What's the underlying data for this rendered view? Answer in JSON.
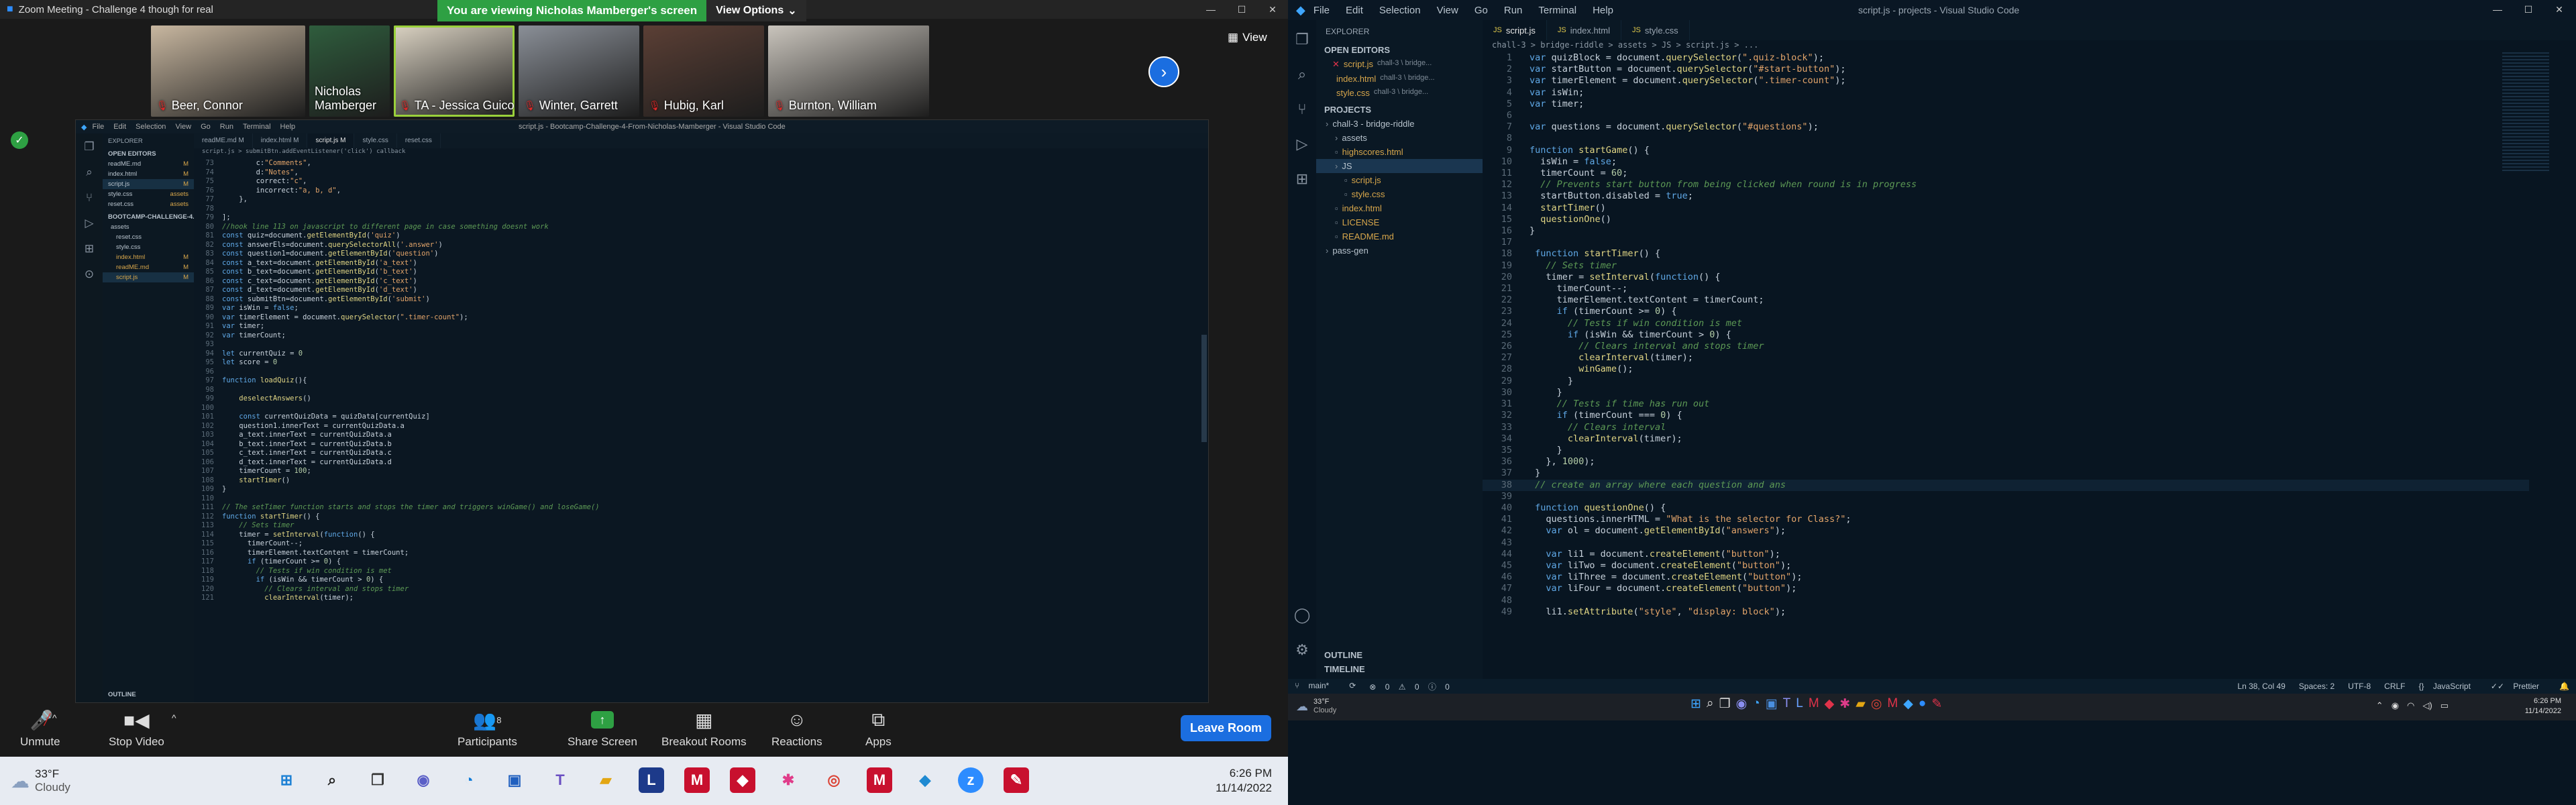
{
  "zoom": {
    "window_title": "Zoom Meeting - Challenge 4 though for real",
    "banner": {
      "message": "You are viewing Nicholas Mamberger's screen",
      "view_options": "View Options"
    },
    "participants": [
      {
        "name": "Beer, Connor",
        "muted": true,
        "bg": "#c8b7a0"
      },
      {
        "name": "Nicholas Mamberger",
        "muted": false,
        "bg": "#2f5d3d"
      },
      {
        "name": "TA - Jessica Guico",
        "muted": true,
        "bg": "#dad2c2"
      },
      {
        "name": "Winter, Garrett",
        "muted": true,
        "bg": "#8a8f97"
      },
      {
        "name": "Hubig, Karl",
        "muted": true,
        "bg": "#5b3f35"
      },
      {
        "name": "Burnton, William",
        "muted": true,
        "bg": "#c9c4bc"
      }
    ],
    "view_label": "View",
    "toolbar": {
      "unmute": "Unmute",
      "stop_video": "Stop Video",
      "participants": "Participants",
      "participants_count": "8",
      "share_screen": "Share Screen",
      "breakout_rooms": "Breakout Rooms",
      "reactions": "Reactions",
      "apps": "Apps",
      "leave": "Leave Room"
    }
  },
  "shared_screen": {
    "menu": [
      "File",
      "Edit",
      "Selection",
      "View",
      "Go",
      "Run",
      "Terminal",
      "Help"
    ],
    "window_title": "script.js - Bootcamp-Challenge-4-From-Nicholas-Mamberger - Visual Studio Code",
    "explorer": {
      "header": "EXPLORER",
      "open_editors": "OPEN EDITORS",
      "open_files": [
        {
          "name": "readME.md",
          "badge": "M"
        },
        {
          "name": "index.html",
          "badge": "M"
        },
        {
          "name": "script.js",
          "badge": "M"
        },
        {
          "name": "style.css",
          "badge": "assets"
        },
        {
          "name": "reset.css",
          "badge": "assets"
        }
      ],
      "project": "BOOTCAMP-CHALLENGE-4...",
      "tree": [
        {
          "name": "assets",
          "badge": ""
        },
        {
          "name": "reset.css",
          "badge": ""
        },
        {
          "name": "style.css",
          "badge": ""
        },
        {
          "name": "index.html",
          "badge": "M"
        },
        {
          "name": "readME.md",
          "badge": "M"
        },
        {
          "name": "script.js",
          "badge": "M"
        }
      ],
      "outline": "OUTLINE"
    },
    "tabs": [
      "readME.md M",
      "index.html M",
      "script.js M",
      "style.css",
      "reset.css"
    ],
    "breadcrumb": "script.js > submitBtn.addEventListener('click') callback",
    "code": [
      {
        "ln": "73",
        "t": "        c:\"Comments\","
      },
      {
        "ln": "74",
        "t": "        d:\"Notes\","
      },
      {
        "ln": "75",
        "t": "        correct:\"c\","
      },
      {
        "ln": "76",
        "t": "        incorrect:\"a, b, d\","
      },
      {
        "ln": "77",
        "t": "    },"
      },
      {
        "ln": "78",
        "t": ""
      },
      {
        "ln": "79",
        "t": "];"
      },
      {
        "ln": "80",
        "t": "//hook line 113 on javascript to different page in case something doesnt work"
      },
      {
        "ln": "81",
        "t": "const quiz=document.getElementById('quiz')"
      },
      {
        "ln": "82",
        "t": "const answerEls=document.querySelectorAll('.answer')"
      },
      {
        "ln": "83",
        "t": "const question1=document.getElementById('question')"
      },
      {
        "ln": "84",
        "t": "const a_text=document.getElementById('a_text')"
      },
      {
        "ln": "85",
        "t": "const b_text=document.getElementById('b_text')"
      },
      {
        "ln": "86",
        "t": "const c_text=document.getElementById('c_text')"
      },
      {
        "ln": "87",
        "t": "const d_text=document.getElementById('d_text')"
      },
      {
        "ln": "88",
        "t": "const submitBtn=document.getElementById('submit')"
      },
      {
        "ln": "89",
        "t": "var isWin = false;"
      },
      {
        "ln": "90",
        "t": "var timerElement = document.querySelector(\".timer-count\");"
      },
      {
        "ln": "91",
        "t": "var timer;"
      },
      {
        "ln": "92",
        "t": "var timerCount;"
      },
      {
        "ln": "93",
        "t": ""
      },
      {
        "ln": "94",
        "t": "let currentQuiz = 0"
      },
      {
        "ln": "95",
        "t": "let score = 0"
      },
      {
        "ln": "96",
        "t": ""
      },
      {
        "ln": "97",
        "t": "function loadQuiz(){"
      },
      {
        "ln": "98",
        "t": ""
      },
      {
        "ln": "99",
        "t": "    deselectAnswers()"
      },
      {
        "ln": "100",
        "t": ""
      },
      {
        "ln": "101",
        "t": "    const currentQuizData = quizData[currentQuiz]"
      },
      {
        "ln": "102",
        "t": "    question1.innerText = currentQuizData.a"
      },
      {
        "ln": "103",
        "t": "    a_text.innerText = currentQuizData.a"
      },
      {
        "ln": "104",
        "t": "    b_text.innerText = currentQuizData.b"
      },
      {
        "ln": "105",
        "t": "    c_text.innerText = currentQuizData.c"
      },
      {
        "ln": "106",
        "t": "    d_text.innerText = currentQuizData.d"
      },
      {
        "ln": "107",
        "t": "    timerCount = 100;"
      },
      {
        "ln": "108",
        "t": "    startTimer()"
      },
      {
        "ln": "109",
        "t": "}"
      },
      {
        "ln": "110",
        "t": ""
      },
      {
        "ln": "111",
        "t": "// The setTimer function starts and stops the timer and triggers winGame() and loseGame()"
      },
      {
        "ln": "112",
        "t": "function startTimer() {"
      },
      {
        "ln": "113",
        "t": "    // Sets timer"
      },
      {
        "ln": "114",
        "t": "    timer = setInterval(function() {"
      },
      {
        "ln": "115",
        "t": "      timerCount--;"
      },
      {
        "ln": "116",
        "t": "      timerElement.textContent = timerCount;"
      },
      {
        "ln": "117",
        "t": "      if (timerCount >= 0) {"
      },
      {
        "ln": "118",
        "t": "        // Tests if win condition is met"
      },
      {
        "ln": "119",
        "t": "        if (isWin && timerCount > 0) {"
      },
      {
        "ln": "120",
        "t": "          // Clears interval and stops timer"
      },
      {
        "ln": "121",
        "t": "          clearInterval(timer);"
      }
    ]
  },
  "left_taskbar": {
    "weather_temp": "33°F",
    "weather_desc": "Cloudy",
    "time": "6:26 PM",
    "date": "11/14/2022"
  },
  "vscode": {
    "menu": [
      "File",
      "Edit",
      "Selection",
      "View",
      "Go",
      "Run",
      "Terminal",
      "Help"
    ],
    "window_title": "script.js - projects - Visual Studio Code",
    "explorer": {
      "header": "EXPLORER",
      "open_editors": "OPEN EDITORS",
      "open_files": [
        {
          "name": "script.js",
          "detail": "chall-3 \\ bridge..."
        },
        {
          "name": "index.html",
          "detail": "chall-3 \\ bridge..."
        },
        {
          "name": "style.css",
          "detail": "chall-3 \\ bridge..."
        }
      ],
      "projects": "PROJECTS",
      "tree": [
        {
          "name": "chall-3 - bridge-riddle",
          "indent": 0
        },
        {
          "name": "assets",
          "indent": 1
        },
        {
          "name": "highscores.html",
          "indent": 1
        },
        {
          "name": "JS",
          "indent": 1
        },
        {
          "name": "script.js",
          "indent": 2
        },
        {
          "name": "style.css",
          "indent": 2
        },
        {
          "name": "index.html",
          "indent": 1
        },
        {
          "name": "LICENSE",
          "indent": 1
        },
        {
          "name": "README.md",
          "indent": 1
        },
        {
          "name": "pass-gen",
          "indent": 0
        }
      ],
      "outline": "OUTLINE",
      "timeline": "TIMELINE"
    },
    "tabs": [
      "script.js",
      "index.html",
      "style.css"
    ],
    "breadcrumb": "chall-3 > bridge-riddle > assets > JS > script.js > ...",
    "code": [
      {
        "ln": "1",
        "t": "var quizBlock = document.querySelector(\".quiz-block\");"
      },
      {
        "ln": "2",
        "t": "var startButton = document.querySelector(\"#start-button\");"
      },
      {
        "ln": "3",
        "t": "var timerElement = document.querySelector(\".timer-count\");"
      },
      {
        "ln": "4",
        "t": "var isWin;"
      },
      {
        "ln": "5",
        "t": "var timer;"
      },
      {
        "ln": "6",
        "t": ""
      },
      {
        "ln": "7",
        "t": "var questions = document.querySelector(\"#questions\");"
      },
      {
        "ln": "8",
        "t": ""
      },
      {
        "ln": "9",
        "t": "function startGame() {"
      },
      {
        "ln": "10",
        "t": "  isWin = false;"
      },
      {
        "ln": "11",
        "t": "  timerCount = 60;"
      },
      {
        "ln": "12",
        "t": "  // Prevents start button from being clicked when round is in progress"
      },
      {
        "ln": "13",
        "t": "  startButton.disabled = true;"
      },
      {
        "ln": "14",
        "t": "  startTimer()"
      },
      {
        "ln": "15",
        "t": "  questionOne()"
      },
      {
        "ln": "16",
        "t": "}"
      },
      {
        "ln": "17",
        "t": ""
      },
      {
        "ln": "18",
        "t": " function startTimer() {"
      },
      {
        "ln": "19",
        "t": "   // Sets timer"
      },
      {
        "ln": "20",
        "t": "   timer = setInterval(function() {"
      },
      {
        "ln": "21",
        "t": "     timerCount--;"
      },
      {
        "ln": "22",
        "t": "     timerElement.textContent = timerCount;"
      },
      {
        "ln": "23",
        "t": "     if (timerCount >= 0) {"
      },
      {
        "ln": "24",
        "t": "       // Tests if win condition is met"
      },
      {
        "ln": "25",
        "t": "       if (isWin && timerCount > 0) {"
      },
      {
        "ln": "26",
        "t": "         // Clears interval and stops timer"
      },
      {
        "ln": "27",
        "t": "         clearInterval(timer);"
      },
      {
        "ln": "28",
        "t": "         winGame();"
      },
      {
        "ln": "29",
        "t": "       }"
      },
      {
        "ln": "30",
        "t": "     }"
      },
      {
        "ln": "31",
        "t": "     // Tests if time has run out"
      },
      {
        "ln": "32",
        "t": "     if (timerCount === 0) {"
      },
      {
        "ln": "33",
        "t": "       // Clears interval"
      },
      {
        "ln": "34",
        "t": "       clearInterval(timer);"
      },
      {
        "ln": "35",
        "t": "     }"
      },
      {
        "ln": "36",
        "t": "   }, 1000);"
      },
      {
        "ln": "37",
        "t": " }"
      },
      {
        "ln": "38",
        "t": " // create an array where each question and ans"
      },
      {
        "ln": "39",
        "t": ""
      },
      {
        "ln": "40",
        "t": " function questionOne() {"
      },
      {
        "ln": "41",
        "t": "   questions.innerHTML = \"What is the selector for Class?\";"
      },
      {
        "ln": "42",
        "t": "   var ol = document.getElementById(\"answers\");"
      },
      {
        "ln": "43",
        "t": ""
      },
      {
        "ln": "44",
        "t": "   var li1 = document.createElement(\"button\");"
      },
      {
        "ln": "45",
        "t": "   var liTwo = document.createElement(\"button\");"
      },
      {
        "ln": "46",
        "t": "   var liThree = document.createElement(\"button\");"
      },
      {
        "ln": "47",
        "t": "   var liFour = document.createElement(\"button\");"
      },
      {
        "ln": "48",
        "t": ""
      },
      {
        "ln": "49",
        "t": "   li1.setAttribute(\"style\", \"display: block\");"
      }
    ],
    "current_line": "38",
    "status": {
      "branch": "main*",
      "errors": "0",
      "warnings": "0",
      "warnings_extra": "0",
      "cursor": "Ln 38, Col 49",
      "spaces": "Spaces: 2",
      "encoding": "UTF-8",
      "eol": "CRLF",
      "language": "JavaScript",
      "formatter": "Prettier"
    }
  },
  "right_taskbar": {
    "weather_temp": "33°F",
    "weather_desc": "Cloudy",
    "time": "6:26 PM",
    "date": "11/14/2022"
  }
}
